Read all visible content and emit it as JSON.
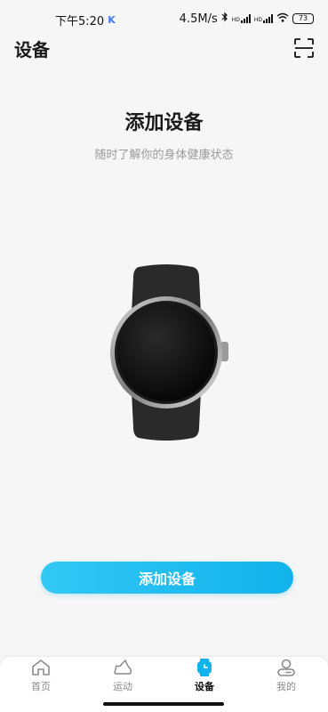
{
  "status_bar": {
    "time": "下午5:20",
    "app_badge": "K",
    "speed": "4.5M/s",
    "signal1_label": "HD",
    "signal2_label": "HD",
    "battery": "73"
  },
  "header": {
    "title": "设备"
  },
  "hero": {
    "title": "添加设备",
    "subtitle": "随时了解你的身体健康状态"
  },
  "primary_action": {
    "label": "添加设备"
  },
  "tabs": [
    {
      "label": "首页",
      "icon": "home-icon",
      "active": false
    },
    {
      "label": "运动",
      "icon": "shoe-icon",
      "active": false
    },
    {
      "label": "设备",
      "icon": "watch-icon",
      "active": true
    },
    {
      "label": "我的",
      "icon": "profile-icon",
      "active": false
    }
  ],
  "colors": {
    "accent": "#12b3ec",
    "background": "#f6f6f6",
    "subtitle": "#9a9a9a"
  }
}
